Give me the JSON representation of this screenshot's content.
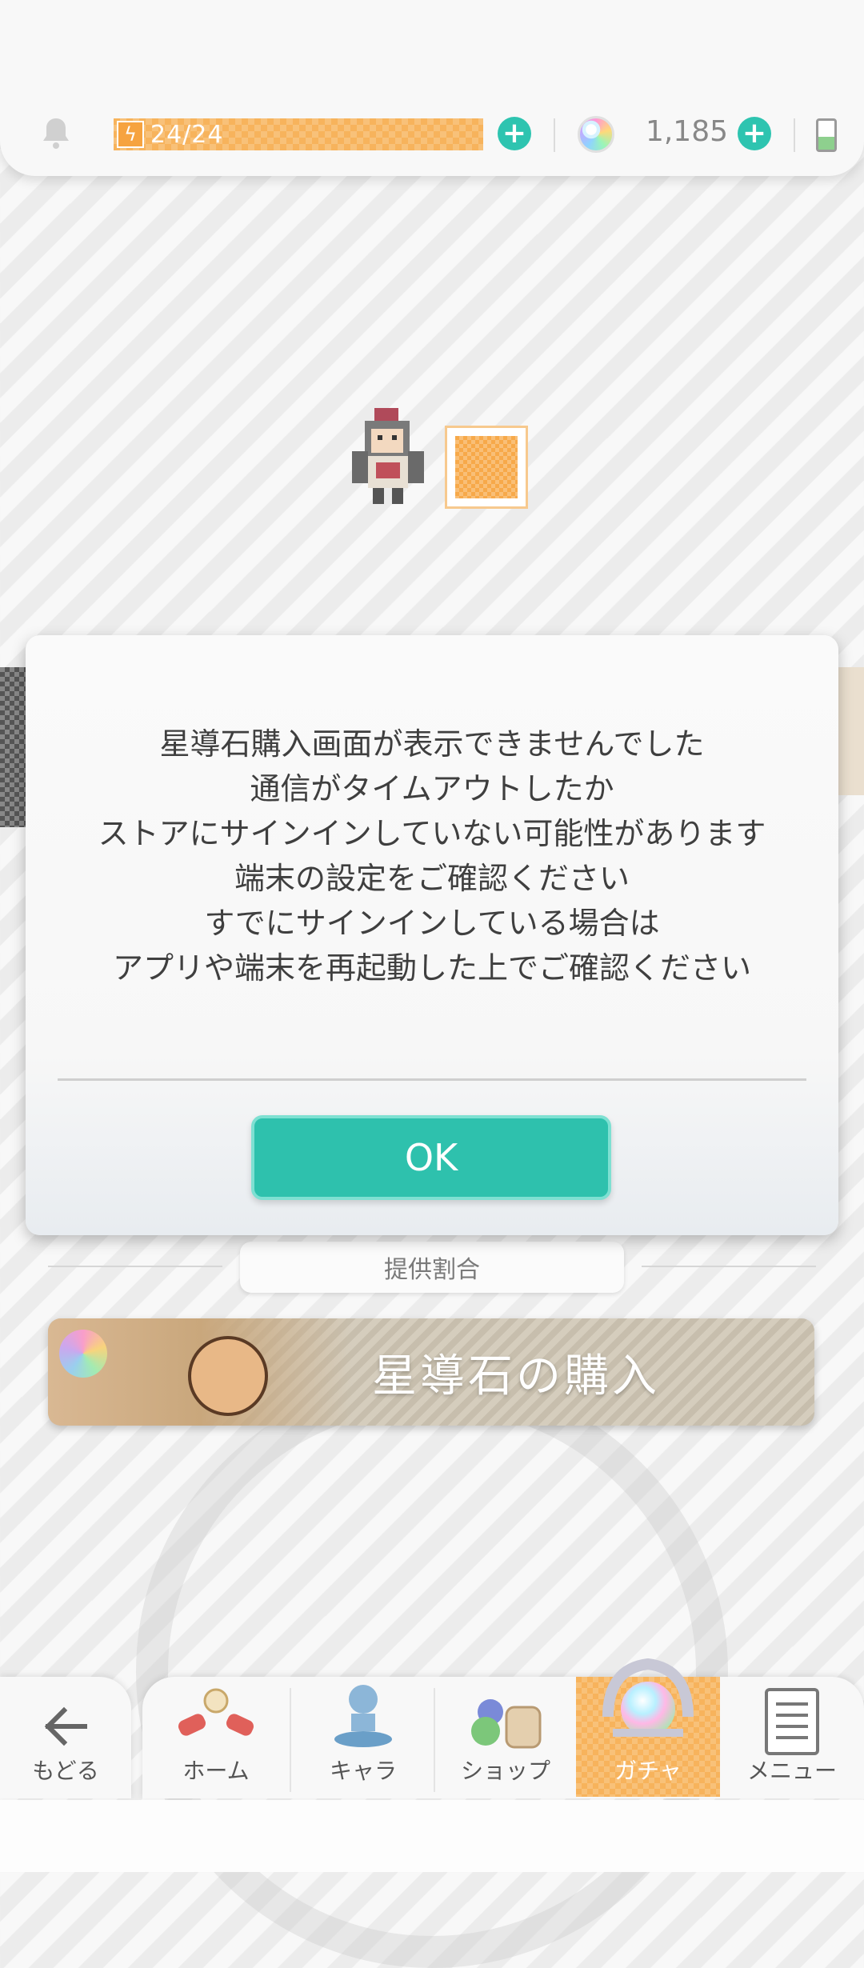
{
  "status_bar": {
    "stamina": "24/24",
    "gems": "1,185"
  },
  "dialog": {
    "lines": [
      "星導石購入画面が表示できませんでした",
      "通信がタイムアウトしたか",
      "ストアにサインインしていない可能性があります",
      "端末の設定をご確認ください",
      "すでにサインインしている場合は",
      "アプリや端末を再起動した上でご確認ください"
    ],
    "ok_label": "OK"
  },
  "gacha": {
    "rates_label": "提供割合",
    "purchase_label": "星導石の購入"
  },
  "nav": {
    "back": "もどる",
    "home": "ホーム",
    "chara": "キャラ",
    "shop": "ショップ",
    "gacha": "ガチャ",
    "menu": "メニュー"
  },
  "colors": {
    "accent": "#2ec1ad",
    "stamina": "#f7b35c"
  }
}
